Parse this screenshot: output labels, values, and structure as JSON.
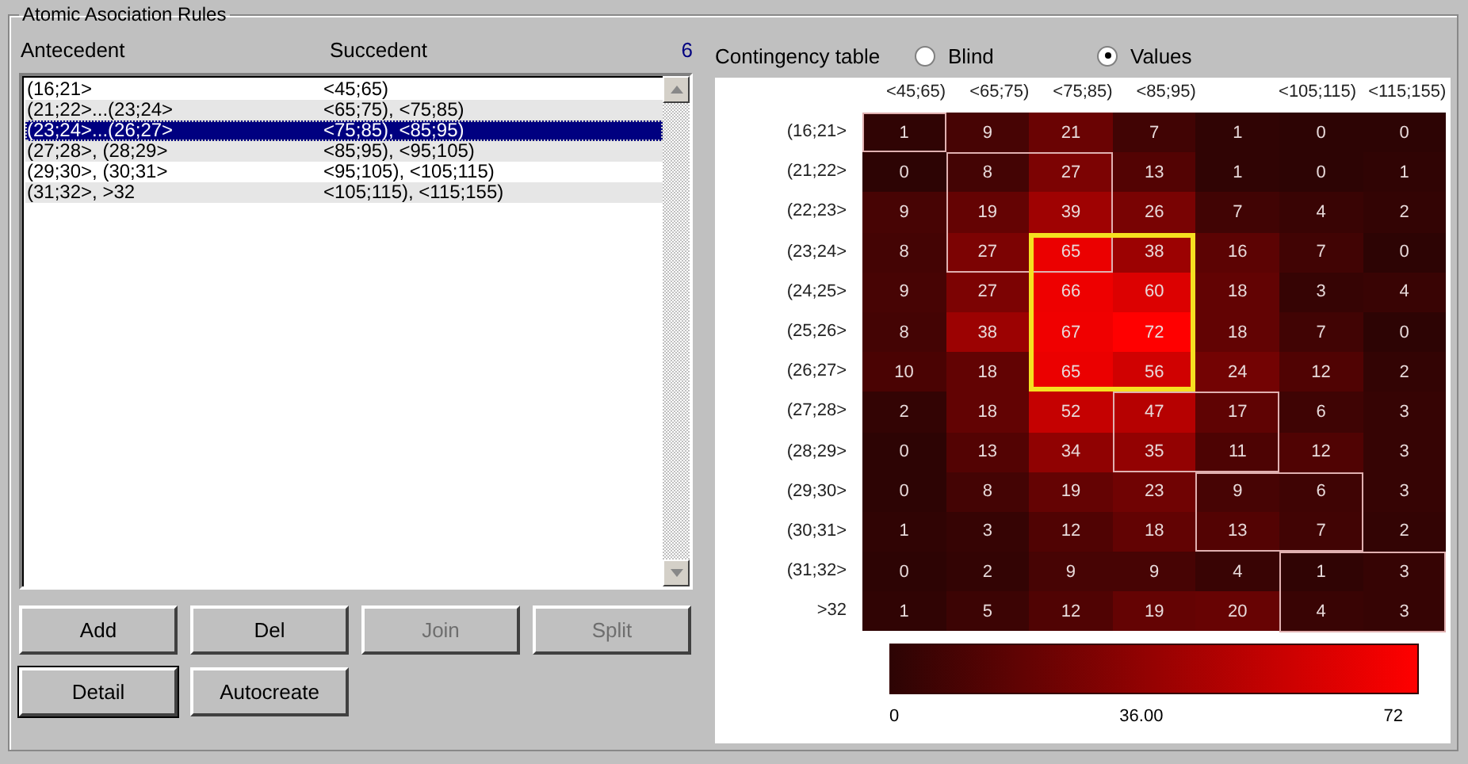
{
  "group_title": "Atomic Asociation Rules",
  "rules_list": {
    "columns": [
      "Antecedent",
      "Succedent"
    ],
    "count": "6",
    "rows": [
      {
        "antecedent": "(16;21>",
        "succedent": "<45;65)",
        "selected": false
      },
      {
        "antecedent": "(21;22>...(23;24>",
        "succedent": "<65;75), <75;85)",
        "selected": false
      },
      {
        "antecedent": "(23;24>...(26;27>",
        "succedent": "<75;85), <85;95)",
        "selected": true
      },
      {
        "antecedent": "(27;28>, (28;29>",
        "succedent": "<85;95), <95;105)",
        "selected": false
      },
      {
        "antecedent": "(29;30>, (30;31>",
        "succedent": "<95;105), <105;115)",
        "selected": false
      },
      {
        "antecedent": "(31;32>, >32",
        "succedent": "<105;115), <115;155)",
        "selected": false
      }
    ]
  },
  "buttons": [
    {
      "label": "Add",
      "disabled": false,
      "default": false
    },
    {
      "label": "Del",
      "disabled": false,
      "default": false
    },
    {
      "label": "Join",
      "disabled": true,
      "default": false
    },
    {
      "label": "Split",
      "disabled": true,
      "default": false
    },
    {
      "label": "Detail",
      "disabled": false,
      "default": true
    },
    {
      "label": "Autocreate",
      "disabled": false,
      "default": false
    }
  ],
  "contingency": {
    "title": "Contingency table",
    "options": [
      {
        "label": "Blind",
        "selected": false
      },
      {
        "label": "Values",
        "selected": true
      }
    ],
    "columns": [
      {
        "label": "<45;65)"
      },
      {
        "label": "<65;75)"
      },
      {
        "label": "<75;85)"
      },
      {
        "label": "<85;95)"
      },
      {},
      {
        "label": "<105;115)"
      },
      {
        "label": "<115;155)"
      }
    ],
    "rows": [
      {
        "label": "(16;21>",
        "cells": [
          "1",
          "9",
          "21",
          "7",
          "1",
          "0",
          "0"
        ]
      },
      {
        "label": "(21;22>",
        "cells": [
          "0",
          "8",
          "27",
          "13",
          "1",
          "0",
          "1"
        ]
      },
      {
        "label": "(22;23>",
        "cells": [
          "9",
          "19",
          "39",
          "26",
          "7",
          "4",
          "2"
        ]
      },
      {
        "label": "(23;24>",
        "cells": [
          "8",
          "27",
          "65",
          "38",
          "16",
          "7",
          "0"
        ]
      },
      {
        "label": "(24;25>",
        "cells": [
          "9",
          "27",
          "66",
          "60",
          "18",
          "3",
          "4"
        ]
      },
      {
        "label": "(25;26>",
        "cells": [
          "8",
          "38",
          "67",
          "72",
          "18",
          "7",
          "0"
        ]
      },
      {
        "label": "(26;27>",
        "cells": [
          "10",
          "18",
          "65",
          "56",
          "24",
          "12",
          "2"
        ]
      },
      {
        "label": "(27;28>",
        "cells": [
          "2",
          "18",
          "52",
          "47",
          "17",
          "6",
          "3"
        ]
      },
      {
        "label": "(28;29>",
        "cells": [
          "0",
          "13",
          "34",
          "35",
          "11",
          "12",
          "3"
        ]
      },
      {
        "label": "(29;30>",
        "cells": [
          "0",
          "8",
          "19",
          "23",
          "9",
          "6",
          "3"
        ]
      },
      {
        "label": "(30;31>",
        "cells": [
          "1",
          "3",
          "12",
          "18",
          "13",
          "7",
          "2"
        ]
      },
      {
        "label": "(31;32>",
        "cells": [
          "0",
          "2",
          "9",
          "9",
          "4",
          "1",
          "3"
        ]
      },
      {
        "label": ">32",
        "cells": [
          "1",
          "5",
          "12",
          "19",
          "20",
          "4",
          "3"
        ]
      }
    ],
    "scale": {
      "min": "0",
      "mid": "36.00",
      "max": "72"
    }
  }
}
